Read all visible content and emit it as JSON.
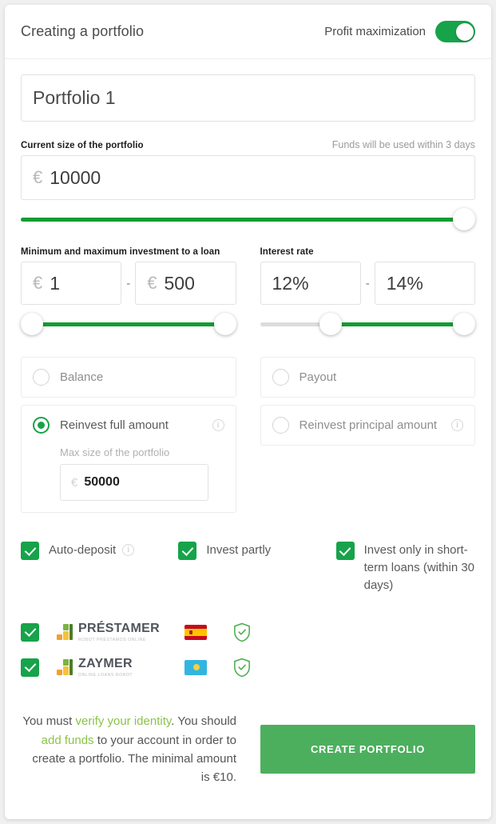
{
  "header": {
    "title": "Creating a portfolio",
    "toggle_label": "Profit maximization",
    "toggle_on": true
  },
  "portfolio_name": {
    "value": "Portfolio 1"
  },
  "size": {
    "label": "Current size of the portfolio",
    "note": "Funds will be used within 3 days",
    "currency": "€",
    "value": "10000",
    "slider_percent": 100
  },
  "investment": {
    "label": "Minimum and maximum investment to a loan",
    "currency": "€",
    "min_value": "1",
    "max_value": "500",
    "separator": "-",
    "slider_min_percent": 0,
    "slider_max_percent": 100
  },
  "interest": {
    "label": "Interest rate",
    "min_value": "12%",
    "max_value": "14%",
    "separator": "-",
    "slider_min_percent": 33,
    "slider_max_percent": 100
  },
  "strategy": {
    "left": [
      {
        "label": "Balance",
        "selected": false,
        "has_info": false
      },
      {
        "label": "Reinvest full amount",
        "selected": true,
        "has_info": true
      }
    ],
    "right": [
      {
        "label": "Payout",
        "selected": false,
        "has_info": false
      },
      {
        "label": "Reinvest principal amount",
        "selected": false,
        "has_info": true
      }
    ],
    "max_size_label": "Max size of the portfolio",
    "max_size_currency": "€",
    "max_size_value": "50000"
  },
  "checkboxes": [
    {
      "label": "Auto-deposit",
      "checked": true,
      "has_info": true
    },
    {
      "label": "Invest partly",
      "checked": true,
      "has_info": false
    },
    {
      "label": "Invest only in short-term loans (within 30 days)",
      "checked": true,
      "has_info": false
    }
  ],
  "lenders": [
    {
      "checked": true,
      "name": "PRÉSTAMER",
      "tagline": "ROBOT PRÉSTAMOS ONLINE",
      "country": "Spain",
      "verified": true
    },
    {
      "checked": true,
      "name": "ZAYMER",
      "tagline": "ONLINE LOANS ROBOT",
      "country": "Kazakhstan",
      "verified": true
    }
  ],
  "footer": {
    "text_part1": "You must ",
    "link1": "verify your identity",
    "text_part2": ". You should ",
    "link2": "add funds",
    "text_part3": " to your account in order to create a portfolio. The minimal amount is €10.",
    "cta_label": "CREATE PORTFOLIO"
  },
  "colors": {
    "brand_green": "#16a34a",
    "track_green": "#129c32",
    "button_green": "#4caf5e",
    "link_green": "#8bc34a"
  }
}
